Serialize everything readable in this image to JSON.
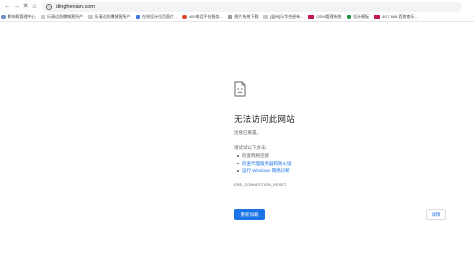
{
  "toolbar": {
    "back_glyph": "←",
    "forward_glyph": "→",
    "reload_glyph": "✕",
    "home_glyph": "⌂",
    "info_glyph": "i",
    "url": "dinghenian.com"
  },
  "bookmarks": [
    {
      "label": "影响帮管理中心",
      "icon": "globe-icon",
      "color": "#6b8ec6"
    },
    {
      "label": "乐清达防爆城营所产",
      "icon": "document-icon",
      "color": "#9aa0a6"
    },
    {
      "label": "乐清达防爆城营所产",
      "icon": "document-icon",
      "color": "#9aa0a6"
    },
    {
      "label": "在线设计位页面片...",
      "icon": "blue-tag-icon",
      "color": "#3f7be0"
    },
    {
      "label": "400电话平台服务...",
      "icon": "red-circle-icon",
      "color": "#e0492f"
    },
    {
      "label": "图片系统下载",
      "icon": "gray-square-icon",
      "color": "#9aa0a6"
    },
    {
      "label": "[温州]乐华合经有...",
      "icon": "document-icon",
      "color": "#9aa0a6"
    },
    {
      "label": "OEM管理系统",
      "icon": "oem-icon",
      "color": "#c2185b"
    },
    {
      "label": "设计模板",
      "icon": "green-shield-icon",
      "color": "#1e8e3e"
    },
    {
      "label": "4G7 668 西岗南乐...",
      "icon": "brand-icon",
      "color": "#c2185b"
    }
  ],
  "error": {
    "title": "无法访问此网站",
    "subtitle": "连接已重置。",
    "try_heading": "请试试以下办法：",
    "suggestions": [
      {
        "text": "检查网络连接",
        "is_link": false
      },
      {
        "text": "检查代理服务器和防火墙",
        "is_link": true
      },
      {
        "text": "运行 Windows 网络诊断",
        "is_link": true
      }
    ],
    "code": "ERR_CONNECTION_RESET",
    "reload_label": "重新加载",
    "details_label": "详情"
  },
  "colors": {
    "accent": "#1a73e8",
    "text_primary": "#202124",
    "text_secondary": "#5f6368"
  }
}
